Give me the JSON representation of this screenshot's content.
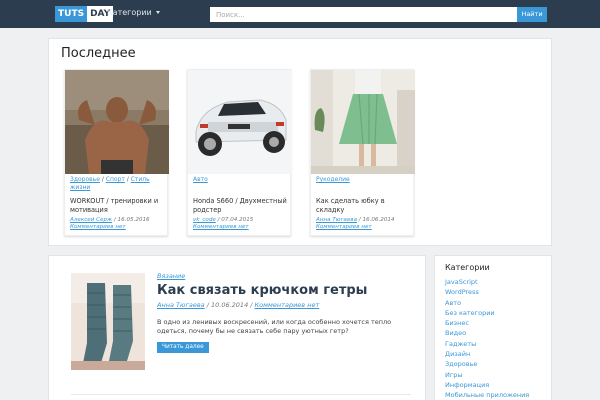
{
  "header": {
    "logo_left": "TUTS",
    "logo_right": "DAY",
    "categories_menu": "Категории",
    "search_placeholder": "Поиск...",
    "search_button": "Найти"
  },
  "latest": {
    "title": "Последнее",
    "cards": [
      {
        "categories": [
          "Здоровье",
          "Спорт",
          "Стиль жизни"
        ],
        "title": "WORKOUT / тренировки и мотивация",
        "author": "Алексей Серж",
        "date": "16.05.2016",
        "comments": "Комментариев нет"
      },
      {
        "categories": [
          "Авто"
        ],
        "title": "Honda S660 / Двухместный родстер",
        "author": "vk_code",
        "date": "07.04.2015",
        "comments": "Комментариев нет"
      },
      {
        "categories": [
          "Рукоделие"
        ],
        "title": "Как сделать юбку в складку",
        "author": "Анна Тюгаева",
        "date": "16.06.2014",
        "comments": "Комментариев нет"
      }
    ]
  },
  "article": {
    "category": "Вязание",
    "title": "Как связать крючком гетры",
    "author": "Анна Тюгаева",
    "date": "10.06.2014",
    "comments": "Комментариев нет",
    "excerpt": "В одно из ленивых воскресений, или когда особенно хочется тепло одеться, почему бы не связать себе пару уютных гетр?",
    "read_more": "Читать далее"
  },
  "sidebar": {
    "title": "Категории",
    "items": [
      "JavaScript",
      "WordPress",
      "Авто",
      "Без категории",
      "Бизнес",
      "Видео",
      "Гаджеты",
      "Дизайн",
      "Здоровье",
      "Игры",
      "Информация",
      "Мобильные приложения"
    ]
  },
  "colors": {
    "topbar": "#2c3d4f",
    "accent": "#3a98d8",
    "background": "#eef0f2"
  },
  "icons": {
    "dropdown": "chevron-down-icon"
  }
}
